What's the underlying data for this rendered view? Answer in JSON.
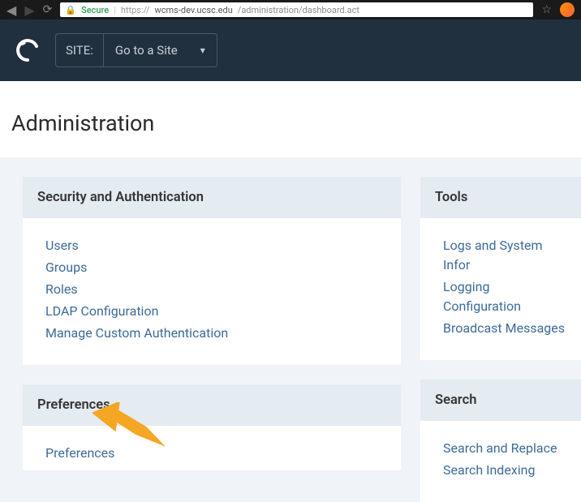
{
  "browser": {
    "secure_label": "Secure",
    "url_protocol": "https://",
    "url_domain": "wcms-dev.ucsc.edu",
    "url_path": "/administration/dashboard.act"
  },
  "topbar": {
    "site_label": "SITE:",
    "site_value": "Go to a Site"
  },
  "page_title": "Administration",
  "panels": {
    "security": {
      "title": "Security and Authentication",
      "links": [
        "Users",
        "Groups",
        "Roles",
        "LDAP Configuration",
        "Manage Custom Authentication"
      ]
    },
    "preferences": {
      "title": "Preferences",
      "links": [
        "Preferences"
      ]
    },
    "tools": {
      "title": "Tools",
      "links": [
        "Logs and System Infor",
        "Logging Configuration",
        "Broadcast Messages"
      ]
    },
    "search": {
      "title": "Search",
      "links": [
        "Search and Replace",
        "Search Indexing"
      ]
    }
  }
}
